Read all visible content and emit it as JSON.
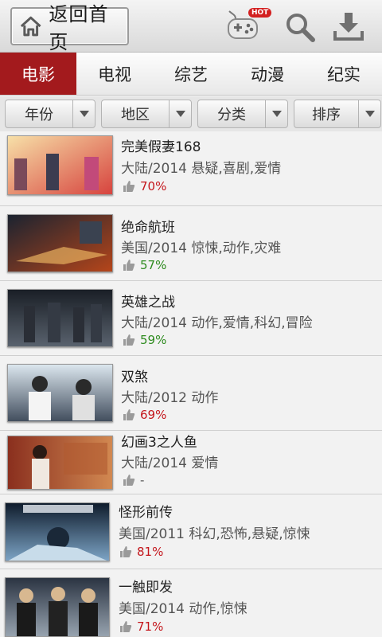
{
  "topbar": {
    "home_label": "返回首页",
    "hot_badge": "HOT"
  },
  "tabs": [
    {
      "label": "电影",
      "active": true
    },
    {
      "label": "电视",
      "active": false
    },
    {
      "label": "综艺",
      "active": false
    },
    {
      "label": "动漫",
      "active": false
    },
    {
      "label": "纪实",
      "active": false
    }
  ],
  "filters": [
    {
      "label": "年份"
    },
    {
      "label": "地区"
    },
    {
      "label": "分类"
    },
    {
      "label": "排序"
    }
  ],
  "movies": [
    {
      "title": "完美假妻168",
      "meta": "大陆/2014  悬疑,喜剧,爱情",
      "rating": "70%",
      "rating_color": "#c4161c",
      "poster_colors": [
        "#f7e0a8",
        "#d6403c"
      ]
    },
    {
      "title": "绝命航班",
      "meta": "美国/2014  惊悚,动作,灾难",
      "rating": "57%",
      "rating_color": "#2e8b1f",
      "poster_colors": [
        "#1b2330",
        "#b8461a"
      ]
    },
    {
      "title": "英雄之战",
      "meta": "大陆/2014  动作,爱情,科幻,冒险",
      "rating": "59%",
      "rating_color": "#2e8b1f",
      "poster_colors": [
        "#1a1f26",
        "#5b6470"
      ]
    },
    {
      "title": "双煞",
      "meta": "大陆/2012  动作",
      "rating": "69%",
      "rating_color": "#c4161c",
      "poster_colors": [
        "#dbe6ee",
        "#3e4a5a"
      ]
    },
    {
      "title": "幻画3之人鱼",
      "meta": "大陆/2014  爱情",
      "rating": "-",
      "rating_color": "#555555",
      "poster_colors": [
        "#8a2f1e",
        "#d38a52"
      ]
    },
    {
      "title": "怪形前传",
      "meta": "美国/2011  科幻,恐怖,悬疑,惊悚",
      "rating": "81%",
      "rating_color": "#c4161c",
      "poster_colors": [
        "#0f1c2c",
        "#7fa7c9"
      ]
    },
    {
      "title": "一触即发",
      "meta": "美国/2014  动作,惊悚",
      "rating": "71%",
      "rating_color": "#c4161c",
      "poster_colors": [
        "#2b3442",
        "#9aa6b2"
      ]
    }
  ]
}
